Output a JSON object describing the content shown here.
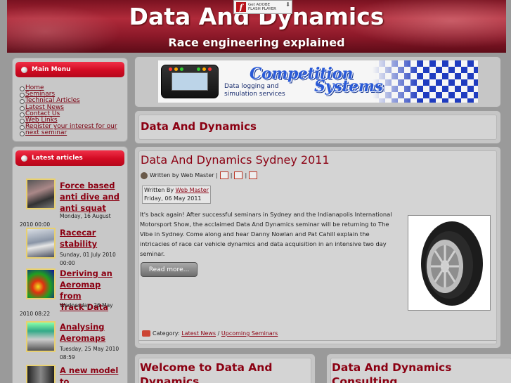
{
  "header": {
    "title": "Data And Dynamics",
    "slogan": "Race engineering explained",
    "flash": {
      "line1": "Get ADOBE",
      "line2": "FLASH PLAYER"
    }
  },
  "main_menu": {
    "title": "Main Menu",
    "items": [
      "Home",
      "Seminars",
      "Technical Articles",
      "Latest News",
      "Contact Us",
      "Web Links",
      "Register your interest for our",
      "next seminar"
    ]
  },
  "latest_articles": {
    "title": "Latest articles",
    "items": [
      {
        "title_lines": [
          "Force based",
          "anti dive and",
          "anti squat"
        ],
        "date_a": "Monday, 16 August",
        "date_b": "2010 00:00"
      },
      {
        "title_lines": [
          "Racecar",
          "stability"
        ],
        "date_a": "Sunday, 01 July 2010",
        "date_b": "00:00"
      },
      {
        "title_lines": [
          "Deriving an",
          "Aeromap from",
          "Track Data"
        ],
        "date_a": "Wednesday, 26 May",
        "date_b": "2010 08:22"
      },
      {
        "title_lines": [
          "Analysing",
          "Aeromaps"
        ],
        "date_a": "Tuesday, 25 May 2010",
        "date_b": "08:59"
      },
      {
        "title_lines": [
          "A new model to"
        ],
        "date_a": "",
        "date_b": ""
      }
    ]
  },
  "banner": {
    "brand_line1": "Competition",
    "brand_line2": "Systems",
    "tagline_1": "Data logging and",
    "tagline_2": "simulation services"
  },
  "section_heading": "Data And Dynamics",
  "post": {
    "title": "Data And Dynamics Sydney 2011",
    "meta_written": "Written by Web Master",
    "byline_prefix": "Written By",
    "byline_author": "Web Master",
    "byline_date": "Friday, 06 May 2011",
    "body": "It's back again! After successful seminars in Sydney and the Indianapolis International Motorsport Show, the acclaimed Data And Dynamics seminar will be returning to The Vibe in Sydney. Come along and hear Danny Nowlan and Pat Cahill explain the intricacies of race car vehicle dynamics and data acquisition in an intensive two day seminar.",
    "read_more": "Read more...",
    "category_label": "Category:",
    "category_1": "Latest News",
    "category_sep": "/",
    "category_2": "Upcoming Seminars"
  },
  "bottom_boxes": {
    "left_title": "Welcome to Data And Dynamics",
    "right_title": "Data And Dynamics Consulting"
  }
}
